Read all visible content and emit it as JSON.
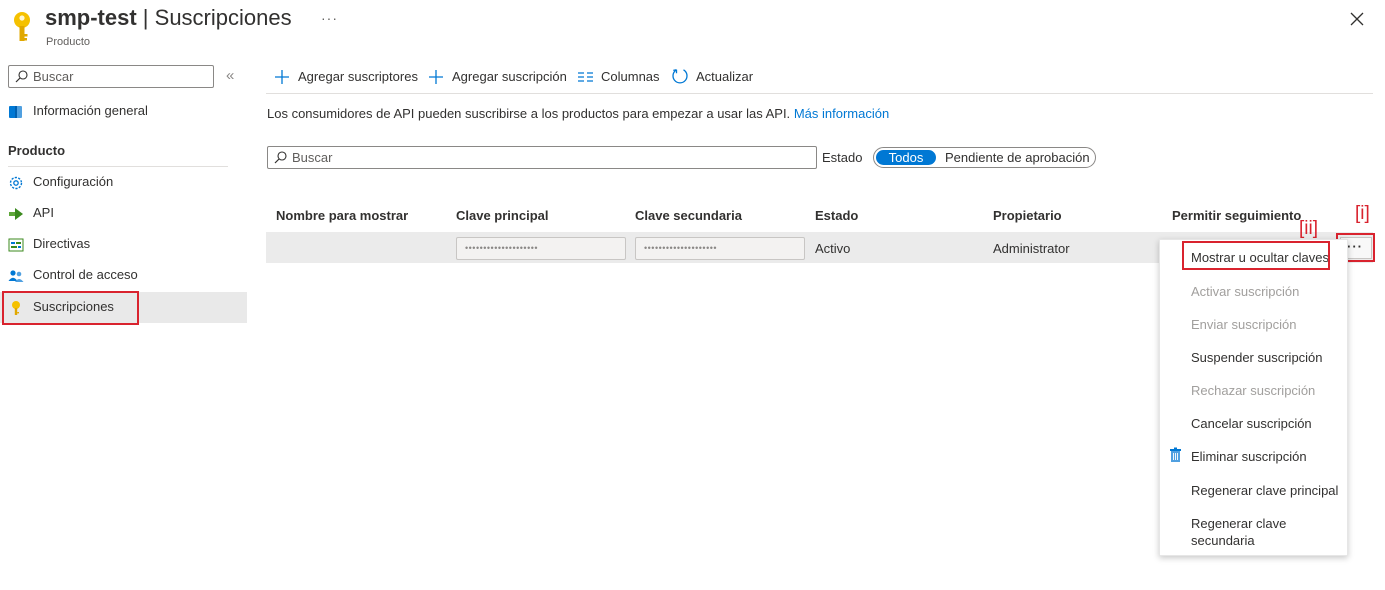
{
  "header": {
    "title_bold": "smp-test",
    "title_sep": " | ",
    "title_rest": "Suscripciones",
    "subtitle": "Producto",
    "more": "···",
    "icon": "key-icon",
    "close_icon": "close-icon"
  },
  "sidebar": {
    "search_placeholder": "Buscar",
    "collapse": "«",
    "overview": {
      "label": "Información general",
      "icon": "info-book-icon"
    },
    "section_title": "Producto",
    "items": [
      {
        "label": "Configuración",
        "icon": "gear-icon"
      },
      {
        "label": "API",
        "icon": "api-arrow-icon"
      },
      {
        "label": "Directivas",
        "icon": "policy-icon"
      },
      {
        "label": "Control de acceso",
        "icon": "people-icon"
      },
      {
        "label": "Suscripciones",
        "icon": "key-icon",
        "active": true
      }
    ]
  },
  "toolbar": {
    "add_subscribers": "Agregar suscriptores",
    "add_subscription": "Agregar suscripción",
    "columns": "Columnas",
    "refresh": "Actualizar"
  },
  "info": {
    "text": "Los consumidores de API pueden suscribirse a los productos para empezar a usar las API.",
    "link": "Más información"
  },
  "filter": {
    "search_placeholder": "Buscar",
    "estado_label": "Estado",
    "options": [
      "Todos",
      "Pendiente de aprobación"
    ],
    "selected": "Todos"
  },
  "table": {
    "headers": [
      "Nombre para mostrar",
      "Clave principal",
      "Clave secundaria",
      "Estado",
      "Propietario",
      "Permitir seguimiento"
    ],
    "rows": [
      {
        "display_name": "",
        "primary_key": "••••••••••••••••••••",
        "secondary_key": "••••••••••••••••••••",
        "state": "Activo",
        "owner": "Administrator",
        "tracing": ""
      }
    ],
    "row_more": "···"
  },
  "annotations": {
    "more_button": "[i]",
    "show_keys": "[ii]"
  },
  "context_menu": {
    "items": [
      {
        "label": "Mostrar u ocultar claves",
        "enabled": true
      },
      {
        "label": "Activar suscripción",
        "enabled": false
      },
      {
        "label": "Enviar suscripción",
        "enabled": false
      },
      {
        "label": "Suspender suscripción",
        "enabled": true
      },
      {
        "label": "Rechazar suscripción",
        "enabled": false
      },
      {
        "label": "Cancelar suscripción",
        "enabled": true
      },
      {
        "label": "Eliminar suscripción",
        "enabled": true,
        "icon": "trash-icon"
      },
      {
        "label": "Regenerar clave principal",
        "enabled": true
      },
      {
        "label": "Regenerar clave",
        "label_line2": "secundaria",
        "enabled": true
      }
    ]
  },
  "colors": {
    "accent": "#0078d4",
    "highlight_red": "#d9232e",
    "key_yellow": "#f5c100"
  }
}
